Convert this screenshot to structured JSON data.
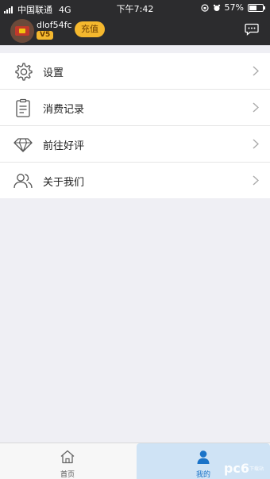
{
  "status_bar": {
    "carrier": "中国联通",
    "network": "4G",
    "time": "下午7:42",
    "battery": "57%",
    "battery_level": 0.57
  },
  "profile": {
    "username": "dlof54fc",
    "vip_level": "V5",
    "recharge_label": "充值",
    "message_icon": "chat-bubble-icon"
  },
  "menu": {
    "items": [
      {
        "label": "设置",
        "icon": "gear-icon"
      },
      {
        "label": "消费记录",
        "icon": "clipboard-icon"
      },
      {
        "label": "前往好评",
        "icon": "diamond-icon"
      },
      {
        "label": "关于我们",
        "icon": "users-icon"
      }
    ]
  },
  "tabbar": {
    "tabs": [
      {
        "label": "首页",
        "icon": "home-icon",
        "active": false
      },
      {
        "label": "我的",
        "icon": "person-icon",
        "active": true
      }
    ]
  },
  "colors": {
    "header_bg": "#2c2c2e",
    "accent_gold": "#f5b82e",
    "active_tab_bg": "#cfe3f5",
    "active_tab_fg": "#1a73c8"
  },
  "watermark": {
    "text": "pc6",
    "sub": "下载站"
  }
}
